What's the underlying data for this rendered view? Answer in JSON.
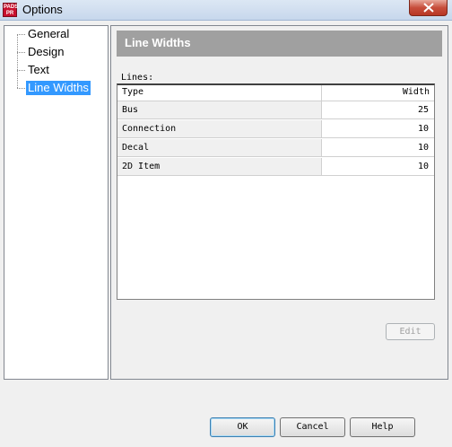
{
  "window": {
    "title": "Options",
    "app_icon_text": [
      "PADS",
      "PR"
    ]
  },
  "tree": {
    "items": [
      {
        "label": "General",
        "selected": false
      },
      {
        "label": "Design",
        "selected": false
      },
      {
        "label": "Text",
        "selected": false
      },
      {
        "label": "Line Widths",
        "selected": true
      }
    ]
  },
  "panel": {
    "header": "Line Widths",
    "lines_label": "Lines:",
    "columns": {
      "type": "Type",
      "width": "Width"
    },
    "rows": [
      {
        "type": "Bus",
        "width": "25"
      },
      {
        "type": "Connection",
        "width": "10"
      },
      {
        "type": "Decal",
        "width": "10"
      },
      {
        "type": "2D Item",
        "width": "10"
      }
    ],
    "edit_label": "Edit"
  },
  "footer": {
    "ok_label": "OK",
    "cancel_label": "Cancel",
    "help_label": "Help"
  },
  "colors": {
    "selection": "#3399ff",
    "header_band": "#a0a0a0",
    "close_button": "#c74e3c"
  }
}
